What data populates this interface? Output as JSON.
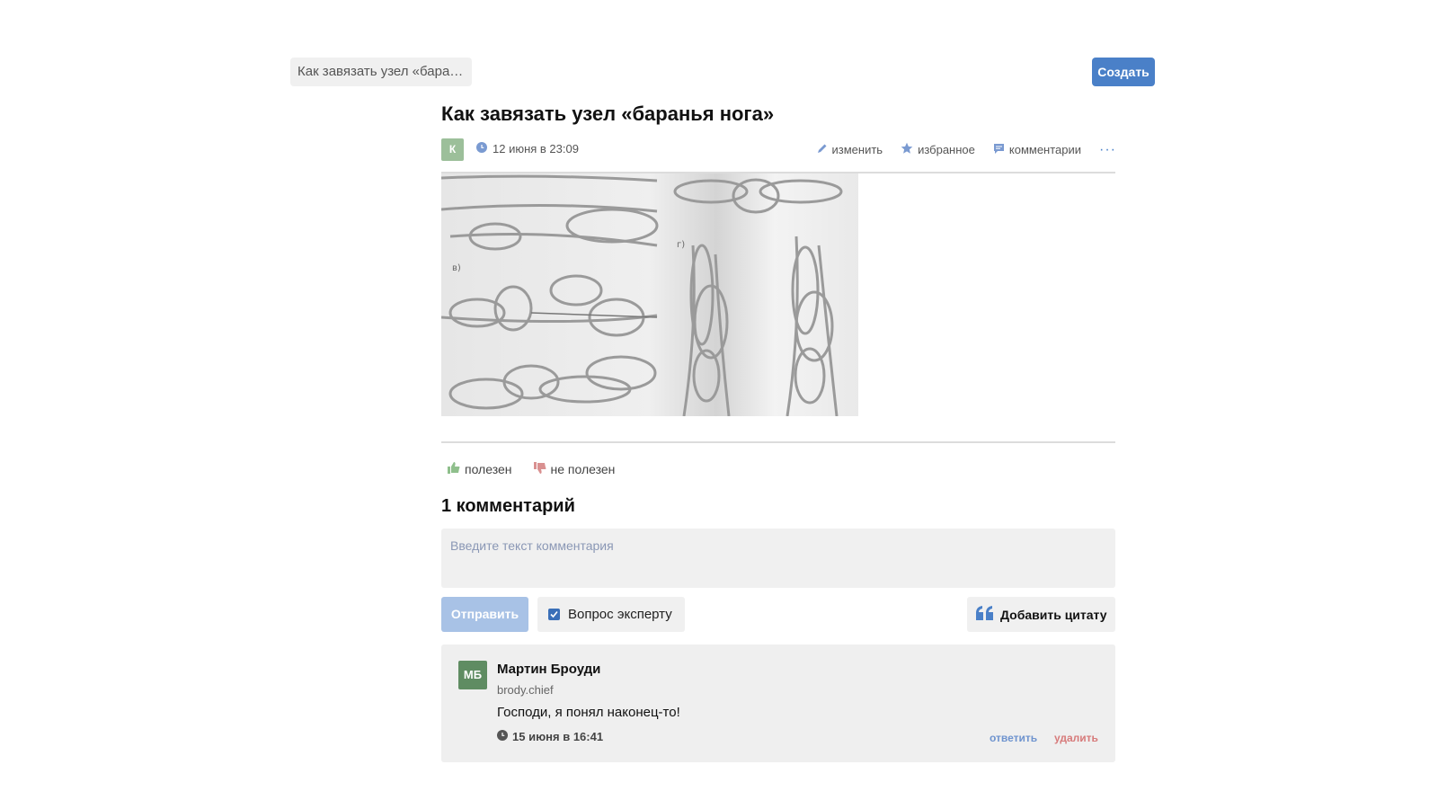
{
  "header": {
    "breadcrumb": "Как завязать узел «баранья нога»",
    "create_label": "Создать"
  },
  "article": {
    "title": "Как завязать узел «баранья нога»",
    "author_initial": "К",
    "date": "12 июня в 23:09",
    "image_alt": "Схема узла баранья нога",
    "actions": {
      "edit": "изменить",
      "favorite": "избранное",
      "comments": "комментарии",
      "more": "···"
    },
    "image_labels": {
      "left": "в)",
      "right": "г)"
    }
  },
  "votes": {
    "useful": "полезен",
    "not_useful": "не полезен"
  },
  "comments": {
    "heading": "1 комментарий",
    "placeholder": "Введите текст комментария",
    "send_label": "Отправить",
    "expert_label": "Вопрос эксперту",
    "quote_label": "Добавить цитату",
    "items": [
      {
        "initials": "МБ",
        "author": "Мартин Броуди",
        "login": "brody.chief",
        "text": "Господи, я понял наконец-то!",
        "date": "15 июня в 16:41",
        "reply": "ответить",
        "delete": "удалить"
      }
    ]
  },
  "colors": {
    "accent": "#4a80c8",
    "accent_light": "#a8c2e6",
    "delete": "#d77b7b",
    "avatar_green": "#5f8c62"
  }
}
